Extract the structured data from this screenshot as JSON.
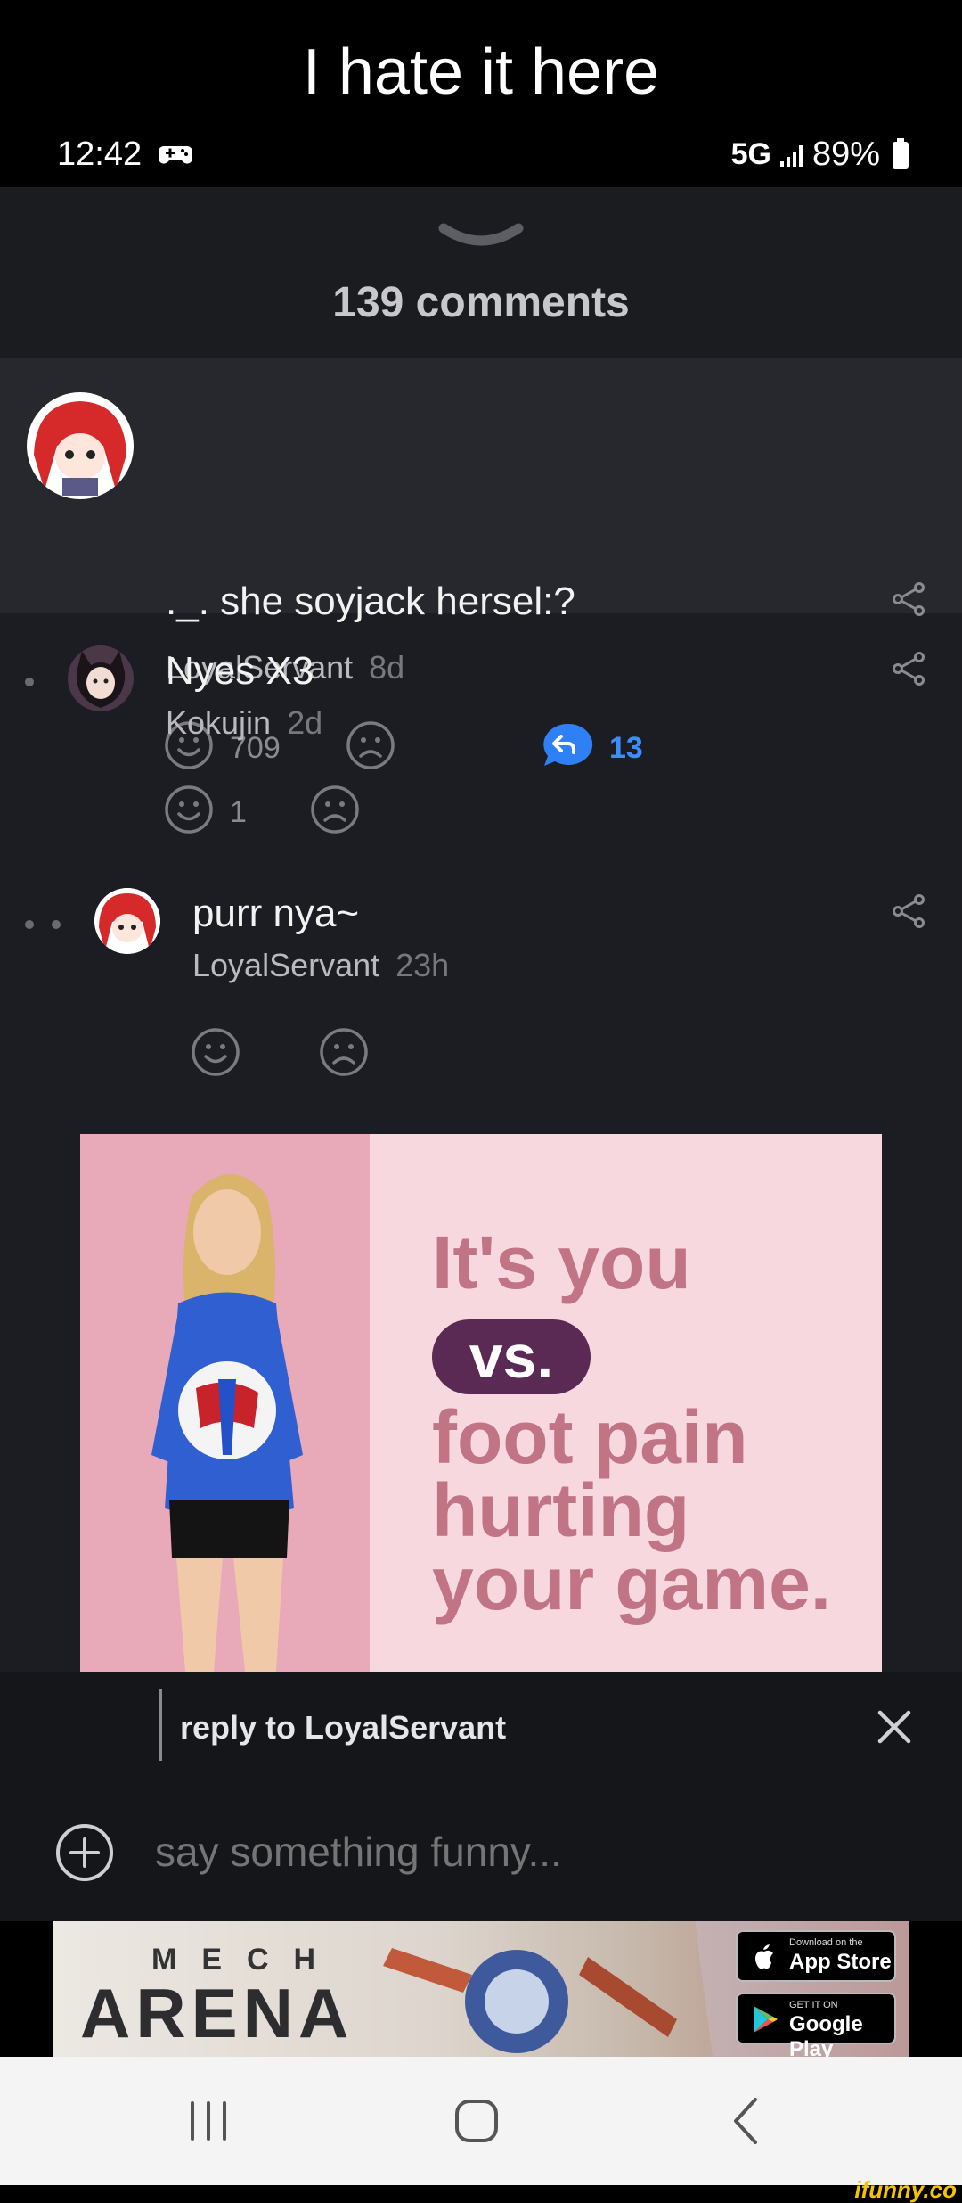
{
  "caption": "I hate it here",
  "status": {
    "time": "12:42",
    "network": "5G",
    "battery": "89%"
  },
  "sheet": {
    "comment_count": "139 comments"
  },
  "comments": [
    {
      "text": "._. she soyjack hersel:?",
      "user": "LoyalServant",
      "age": "8d",
      "likes": "709",
      "replies": "13"
    },
    {
      "text": "Nyes X3",
      "user": "Kokujin",
      "age": "2d",
      "likes": "1"
    },
    {
      "text": "purr nya~",
      "user": "LoyalServant",
      "age": "23h"
    }
  ],
  "ad": {
    "lines": [
      "It's you",
      "vs.",
      "foot pain",
      "hurting",
      "your game."
    ]
  },
  "reply": {
    "label": "reply to LoyalServant",
    "placeholder": "say something funny..."
  },
  "banner": {
    "mech": "MECH",
    "arena": "ARENA",
    "appstore_small": "Download on the",
    "appstore": "App Store",
    "googleplay_small": "GET IT ON",
    "googleplay": "Google Play"
  },
  "watermark": "ifunny.co",
  "colors": {
    "accent": "#3d8dff",
    "sheet_bg": "#1c1d22",
    "highlight_bg": "#27282d"
  },
  "icons": [
    "game-controller-icon",
    "signal-icon",
    "battery-icon",
    "share-icon",
    "smile-icon",
    "frown-icon",
    "reply-icon",
    "close-icon",
    "plus-circle-icon",
    "recents-icon",
    "home-icon",
    "back-icon"
  ]
}
